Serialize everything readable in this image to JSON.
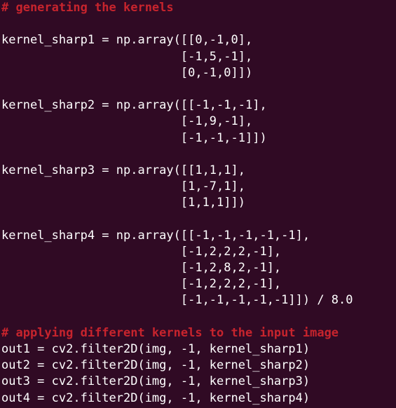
{
  "editor": {
    "colors": {
      "background": "#300a24",
      "text": "#ffffff",
      "comment": "#c7242d"
    },
    "lines": [
      {
        "type": "comment",
        "text": "# generating the kernels"
      },
      {
        "type": "blank",
        "text": ""
      },
      {
        "type": "code",
        "text": "kernel_sharp1 = np.array([[0,-1,0],"
      },
      {
        "type": "code",
        "text": "                         [-1,5,-1],"
      },
      {
        "type": "code",
        "text": "                         [0,-1,0]])"
      },
      {
        "type": "blank",
        "text": ""
      },
      {
        "type": "code",
        "text": "kernel_sharp2 = np.array([[-1,-1,-1],"
      },
      {
        "type": "code",
        "text": "                         [-1,9,-1],"
      },
      {
        "type": "code",
        "text": "                         [-1,-1,-1]])"
      },
      {
        "type": "blank",
        "text": ""
      },
      {
        "type": "code",
        "text": "kernel_sharp3 = np.array([[1,1,1],"
      },
      {
        "type": "code",
        "text": "                         [1,-7,1],"
      },
      {
        "type": "code",
        "text": "                         [1,1,1]])"
      },
      {
        "type": "blank",
        "text": ""
      },
      {
        "type": "code",
        "text": "kernel_sharp4 = np.array([[-1,-1,-1,-1,-1],"
      },
      {
        "type": "code",
        "text": "                         [-1,2,2,2,-1],"
      },
      {
        "type": "code",
        "text": "                         [-1,2,8,2,-1],"
      },
      {
        "type": "code",
        "text": "                         [-1,2,2,2,-1],"
      },
      {
        "type": "code",
        "text": "                         [-1,-1,-1,-1,-1]]) / 8.0"
      },
      {
        "type": "blank",
        "text": ""
      },
      {
        "type": "comment",
        "text": "# applying different kernels to the input image"
      },
      {
        "type": "code",
        "text": "out1 = cv2.filter2D(img, -1, kernel_sharp1)"
      },
      {
        "type": "code",
        "text": "out2 = cv2.filter2D(img, -1, kernel_sharp2)"
      },
      {
        "type": "code",
        "text": "out3 = cv2.filter2D(img, -1, kernel_sharp3)"
      },
      {
        "type": "code",
        "text": "out4 = cv2.filter2D(img, -1, kernel_sharp4)"
      }
    ]
  }
}
